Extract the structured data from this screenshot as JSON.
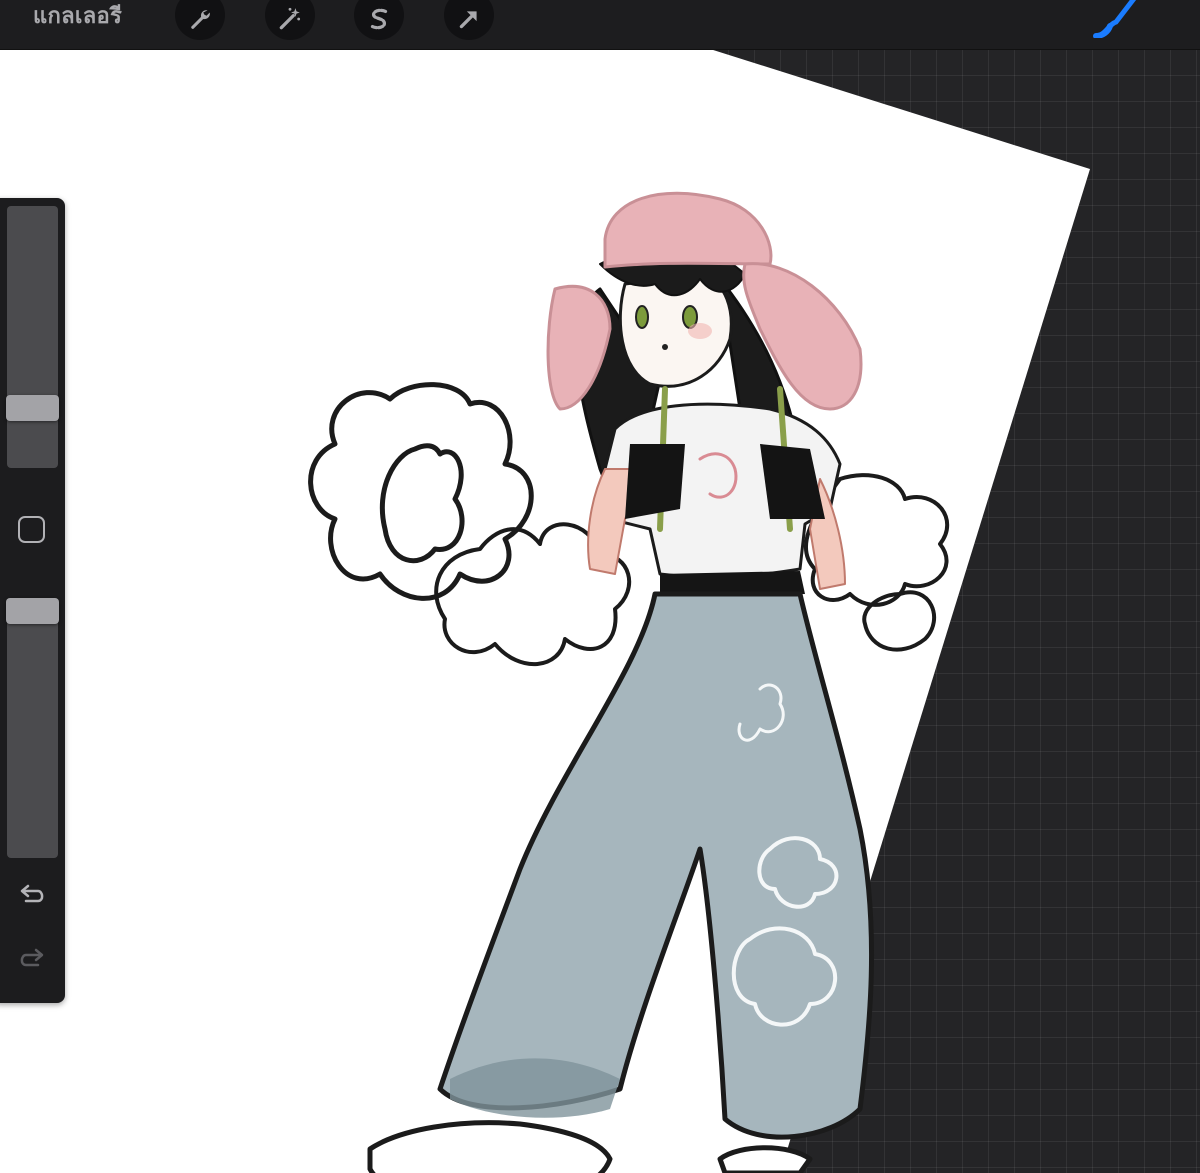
{
  "topbar": {
    "gallery_label": "แกลเลอรี",
    "tools": [
      {
        "name": "actions",
        "icon": "wrench-icon"
      },
      {
        "name": "adjustments",
        "icon": "magic-wand-icon"
      },
      {
        "name": "selection",
        "icon": "selection-s-icon"
      },
      {
        "name": "transform",
        "icon": "arrow-cursor-icon"
      }
    ],
    "brush_icon": "brush-icon",
    "accent_color": "#1a7cff"
  },
  "sidebar": {
    "brush_size_level": 0.78,
    "opacity_level": 0.05,
    "modify_icon": "square-icon",
    "undo_icon": "undo-icon",
    "redo_icon": "redo-icon"
  },
  "canvas": {
    "background_color": "#ffffff",
    "artwork": "sketch-character-with-pink-hat-and-blue-pants"
  }
}
